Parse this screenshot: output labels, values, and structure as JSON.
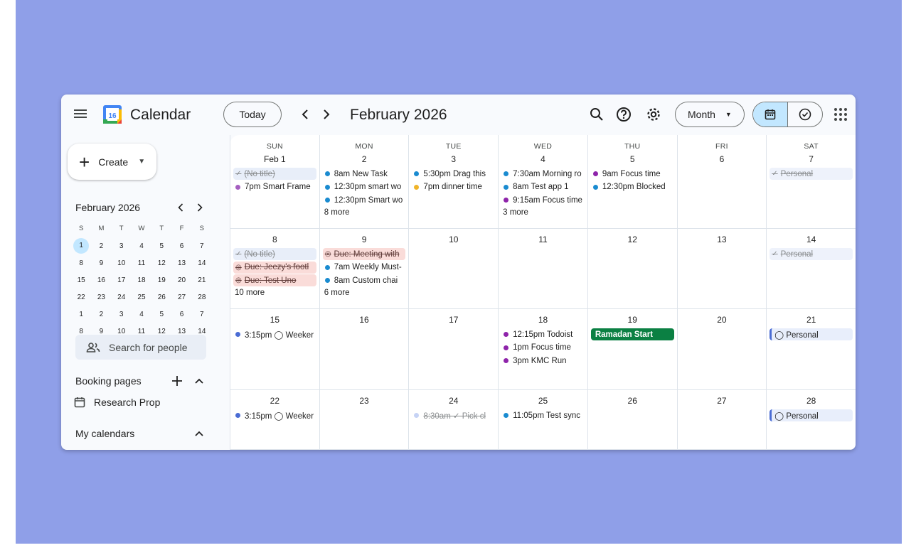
{
  "app": {
    "title": "Calendar",
    "logo_day": "16"
  },
  "header": {
    "today_label": "Today",
    "period": "February 2026",
    "view_label": "Month"
  },
  "sidebar": {
    "create_label": "Create",
    "mini_title": "February 2026",
    "weekday_initials": [
      "S",
      "M",
      "T",
      "W",
      "T",
      "F",
      "S"
    ],
    "weeks": [
      [
        "1",
        "2",
        "3",
        "4",
        "5",
        "6",
        "7"
      ],
      [
        "8",
        "9",
        "10",
        "11",
        "12",
        "13",
        "14"
      ],
      [
        "15",
        "16",
        "17",
        "18",
        "19",
        "20",
        "21"
      ],
      [
        "22",
        "23",
        "24",
        "25",
        "26",
        "27",
        "28"
      ],
      [
        "1",
        "2",
        "3",
        "4",
        "5",
        "6",
        "7"
      ],
      [
        "8",
        "9",
        "10",
        "11",
        "12",
        "13",
        "14"
      ]
    ],
    "search_people": "Search for people",
    "booking_title": "Booking pages",
    "booking_item": "Research Prop",
    "my_calendars": "My calendars"
  },
  "grid": {
    "weekdays": [
      "SUN",
      "MON",
      "TUE",
      "WED",
      "THU",
      "FRI",
      "SAT"
    ],
    "weeks": [
      [
        {
          "day": "Feb 1",
          "events": [
            {
              "text": "(No title)",
              "style": "done-chip",
              "color": "#e8eef9"
            },
            {
              "text": "7pm Smart Frame",
              "dot": "#a55fc0"
            }
          ]
        },
        {
          "day": "2",
          "events": [
            {
              "text": "8am New Task",
              "dot": "#1a8bd0"
            },
            {
              "text": "12:30pm smart wo",
              "dot": "#1a8bd0"
            },
            {
              "text": "12:30pm Smart wo",
              "dot": "#1a8bd0"
            }
          ],
          "more": "8 more"
        },
        {
          "day": "3",
          "events": [
            {
              "text": "5:30pm Drag this",
              "dot": "#1a8bd0"
            },
            {
              "text": "7pm dinner time",
              "dot": "#f0b429"
            }
          ]
        },
        {
          "day": "4",
          "events": [
            {
              "text": "7:30am Morning ro",
              "dot": "#1a8bd0"
            },
            {
              "text": "8am Test app 1",
              "dot": "#1a8bd0"
            },
            {
              "text": "9:15am Focus time",
              "dot": "#8e24aa"
            }
          ],
          "more": "3 more"
        },
        {
          "day": "5",
          "events": [
            {
              "text": "9am Focus time",
              "dot": "#8e24aa"
            },
            {
              "text": "12:30pm Blocked",
              "dot": "#1a8bd0"
            }
          ]
        },
        {
          "day": "6",
          "events": []
        },
        {
          "day": "7",
          "events": [
            {
              "text": "Personal",
              "style": "done-chip",
              "color": "#eef2fb"
            }
          ]
        }
      ],
      [
        {
          "day": "8",
          "events": [
            {
              "text": "(No title)",
              "style": "done-chip",
              "color": "#e8eef9"
            },
            {
              "text": "Due: Jeezy's footl",
              "style": "due",
              "color": "#fadcd9"
            },
            {
              "text": "Due: Test Uno",
              "style": "due",
              "color": "#fadcd9"
            }
          ],
          "more": "10 more"
        },
        {
          "day": "9",
          "events": [
            {
              "text": "Due: Meeting with",
              "style": "due",
              "color": "#fadcd9"
            },
            {
              "text": "7am Weekly Must-",
              "dot": "#1a8bd0"
            },
            {
              "text": "8am Custom chai",
              "dot": "#1a8bd0"
            }
          ],
          "more": "6 more"
        },
        {
          "day": "10",
          "events": []
        },
        {
          "day": "11",
          "events": []
        },
        {
          "day": "12",
          "events": []
        },
        {
          "day": "13",
          "events": []
        },
        {
          "day": "14",
          "events": [
            {
              "text": "Personal",
              "style": "done-chip",
              "color": "#eef2fb"
            }
          ]
        }
      ],
      [
        {
          "day": "15",
          "events": [
            {
              "text": "3:15pm ◯ Weeker",
              "dot": "#4a6cd4"
            }
          ]
        },
        {
          "day": "16",
          "events": []
        },
        {
          "day": "17",
          "events": []
        },
        {
          "day": "18",
          "events": [
            {
              "text": "12:15pm Todoist",
              "dot": "#8e24aa"
            },
            {
              "text": "1pm Focus time",
              "dot": "#8e24aa"
            },
            {
              "text": "3pm KMC Run",
              "dot": "#8e24aa"
            }
          ]
        },
        {
          "day": "19",
          "events": [
            {
              "text": "Ramadan Start",
              "style": "allday",
              "color": "#0b8043"
            }
          ]
        },
        {
          "day": "20",
          "events": []
        },
        {
          "day": "21",
          "events": [
            {
              "text": "◯ Personal",
              "style": "task",
              "color": "#e8eefb"
            }
          ]
        }
      ],
      [
        {
          "day": "22",
          "events": [
            {
              "text": "3:15pm ◯ Weeker",
              "dot": "#4a6cd4"
            }
          ]
        },
        {
          "day": "23",
          "events": []
        },
        {
          "day": "24",
          "events": [
            {
              "text": "8:30am ✓ Pick cl",
              "style": "done",
              "dot": "#c6d3f5"
            }
          ]
        },
        {
          "day": "25",
          "events": [
            {
              "text": "11:05pm Test sync",
              "dot": "#1a8bd0"
            }
          ]
        },
        {
          "day": "26",
          "events": []
        },
        {
          "day": "27",
          "events": []
        },
        {
          "day": "28",
          "events": [
            {
              "text": "◯ Personal",
              "style": "task",
              "color": "#e8eefb"
            }
          ]
        }
      ]
    ]
  }
}
